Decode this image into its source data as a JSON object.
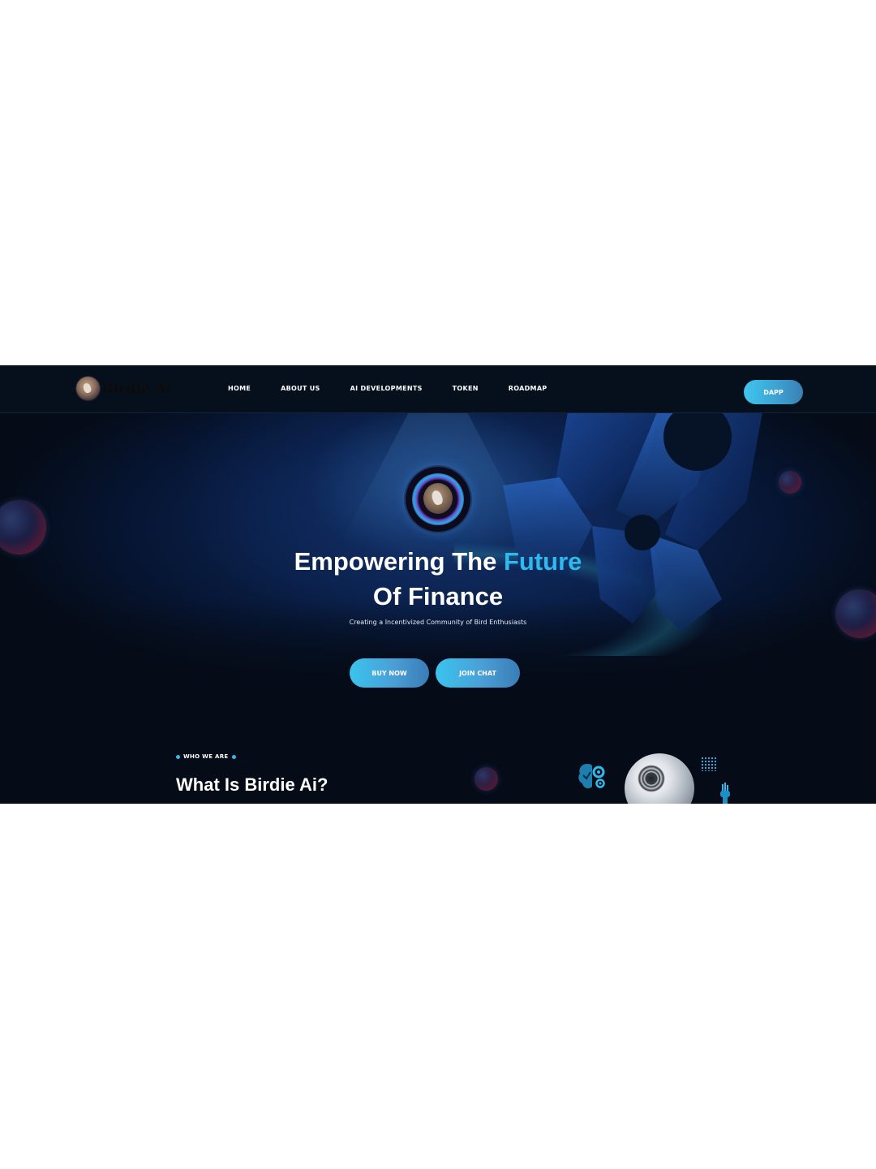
{
  "brand": {
    "name": "Birdie Ai"
  },
  "nav": {
    "items": [
      {
        "label": "HOME"
      },
      {
        "label": "ABOUT US"
      },
      {
        "label": "AI DEVELOPMENTS"
      },
      {
        "label": "TOKEN"
      },
      {
        "label": "ROADMAP"
      }
    ],
    "cta_label": "DAPP"
  },
  "hero": {
    "title_part1": "Empowering The ",
    "title_accent": "Future",
    "title_line2": "Of Finance",
    "subtitle": "Creating a Incentivized Community of Bird Enthusiasts",
    "buttons": {
      "buy_label": "BUY NOW",
      "join_label": "JOIN CHAT"
    }
  },
  "about": {
    "eyebrow": "WHO WE ARE",
    "title": "What Is Birdie Ai?"
  },
  "colors": {
    "accent": "#2fb9ee",
    "background": "#050c18",
    "nav_background": "#06101d",
    "button_gradient_start": "#3ac4ee",
    "button_gradient_end": "#3a7cb6"
  },
  "icons": [
    "bird-logo-icon",
    "brain-gear-icon",
    "robot-head-icon",
    "dot-grid-icon",
    "robot-hand-icon"
  ]
}
